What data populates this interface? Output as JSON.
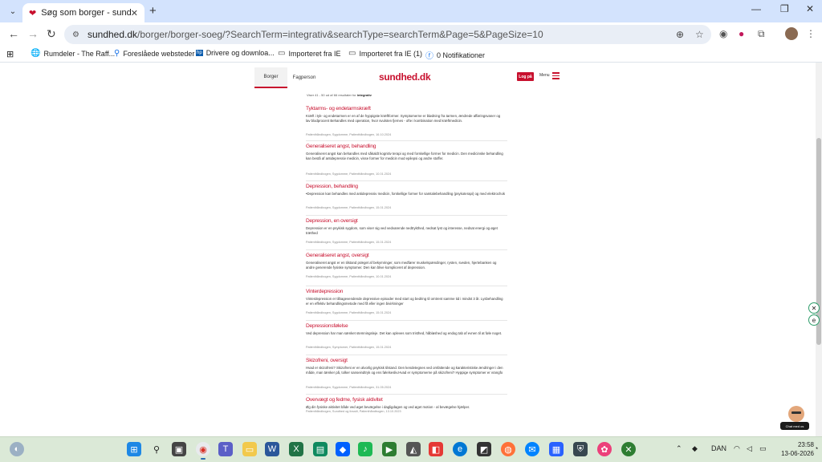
{
  "browser": {
    "tab_title": "Søg som borger - sundhed.dk",
    "url_domain": "sundhed.dk",
    "url_path": "/borger/borger-soeg/?SearchTerm=integrativ&searchType=searchTerm&Page=5&PageSize=10"
  },
  "bookmarks": [
    {
      "icon": "globe-icon",
      "label": "Rumdeler - The Raff..."
    },
    {
      "icon": "search-icon",
      "label": "Foreslåede websteder"
    },
    {
      "icon": "hp-icon",
      "label": "Drivere og downloa..."
    },
    {
      "icon": "folder-icon",
      "label": "Importeret fra IE"
    },
    {
      "icon": "folder-icon",
      "label": "Importeret fra IE (1)"
    },
    {
      "icon": "facebook-icon",
      "label": "0 Notifikationer"
    }
  ],
  "site": {
    "nav_borger": "Borger",
    "nav_fagperson": "Fagperson",
    "logo": "sundhed.dk",
    "login": "Log på",
    "menu": "Menu",
    "results_prefix": "Viser 41 - 50 ud af 66 resultater for ",
    "results_term": "integrativ",
    "brand_color": "#c8102e"
  },
  "results": [
    {
      "title": "Tyktarms- og endetarmskræft",
      "desc": "Kræft i tyk- og endetarmen er en af de hyppigste kræftformer. Symptomerne er blødning fra tarmen, ændrede afføringsvaner og lav blodprocent Behandles med operation, hvor svulsten fjernes - ofte i kombination med kræftmedicin.",
      "meta": "Patienthåndbogen, Sygdomme, Patienthåndbogen, 16.10.2024"
    },
    {
      "title": "Generaliseret angst, behandling",
      "desc": "Generaliseret angst kan behandles med såkaldt kognitiv terapi og med forskellige former for medicin. Den medicinske behandling kan bestå af antidepressiv medicin, visse former for medicin mod epilepsi og andre stoffer.",
      "meta": "Patienthåndbogen, Sygdomme, Patienthåndbogen, 10.01.2024"
    },
    {
      "title": "Depression, behandling",
      "desc": "•Depression kan behandles med antidepressiv medicin, forskellige former for samtalebehandling (psykoterapi) og med elektrochok",
      "meta": "Patienthåndbogen, Sygdomme, Patienthåndbogen, 15.01.2024"
    },
    {
      "title": "Depression, en oversigt",
      "desc": "Depression er en psykisk sygdom, som viser sig ved vedvarende nedtrykthed, nedsat lyst og interesse, nedsat energi og øget træthed",
      "meta": "Patienthåndbogen, Sygdomme, Patienthåndbogen, 15.01.2024"
    },
    {
      "title": "Generaliseret angst, oversigt",
      "desc": "Generaliseret angst er en tilstand præget af bekymringer, som medfører muskelspændinger, rysten, sveden, hjertebanken og andre generende fysiske symptomer. Den kan blive kompliceret af depression.",
      "meta": "Patienthåndbogen, Sygdomme, Patienthåndbogen, 10.01.2024"
    },
    {
      "title": "Vinterdepression",
      "desc": "Vinterdepression er tilbagevendende depressive episoder med start og bedring til omtrent samme tid i mindst 3 år. Lysbehandling er en effektiv behandlingsmetode med få eller ingen bivirkninger",
      "meta": "Patienthåndbogen, Sygdomme, Patienthåndbogen, 15.01.2024"
    },
    {
      "title": "Depressionsfølelse",
      "desc": "Ved depression har man sænket stemningsleje. Det kan opleves som tristhed, håbløshed og endog tab af evnen til at føle noget.",
      "meta": "Patienthåndbogen, Symptomer, Patienthåndbogen, 15.01.2024"
    },
    {
      "title": "Skizofreni, oversigt",
      "desc": "Hvad er skizofreni? Skizofreni er en alvorlig psykisk tilstand. Den kendetegnes ved omfattende og karakteristiske ændringer i den måde, man tænker på, tolker sanseindtryk og ens følelsesliv.Hvad er symptomerne på skizofreni? Hyppige symptomer er vrangfo",
      "meta": "Patienthåndbogen, Sygdomme, Patienthåndbogen, 31.05.2024"
    },
    {
      "title": "Overvægt og fedme, fysisk aktivitet",
      "desc": "Øg din fysiske aktivitet både ved øget bevægelse i dagligdagen og ved øget motion - al bevægelse hjælper.",
      "meta": "Patienthåndbogen, Sundhed og livsstil, Patienthåndbogen, 13.10.2023"
    }
  ],
  "chat": {
    "label": "Chat med os"
  },
  "taskbar": {
    "language": "DAN",
    "time": "23:58",
    "date": "13-06-2026"
  }
}
